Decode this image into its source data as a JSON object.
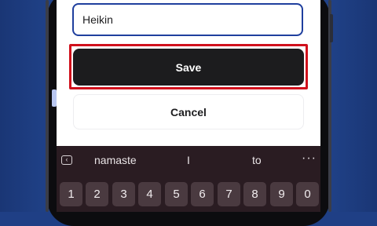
{
  "form": {
    "name_value": "Heikin",
    "save_label": "Save",
    "cancel_label": "Cancel"
  },
  "keyboard": {
    "collapse_icon": "‹",
    "suggestions": [
      "namaste",
      "I",
      "to"
    ],
    "more_icon": "···",
    "number_keys": [
      "1",
      "2",
      "3",
      "4",
      "5",
      "6",
      "7",
      "8",
      "9",
      "0"
    ]
  },
  "colors": {
    "highlight": "#d0101c",
    "save_bg": "#1c1c1e",
    "field_border": "#1f3f9e",
    "background": "#1f3f85"
  }
}
